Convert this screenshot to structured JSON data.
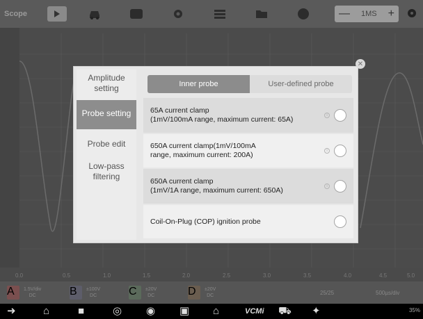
{
  "app": {
    "title": "Scope"
  },
  "toolbar": {
    "timebase": "1MS",
    "minus": "—",
    "plus": "+"
  },
  "x_axis_labels": [
    "0.0",
    "0.5",
    "1.0",
    "1.5",
    "2.0",
    "2.5",
    "3.0",
    "3.5",
    "4.0",
    "4.5",
    "5.0"
  ],
  "channels": [
    {
      "id": "A",
      "line1": "1.5V/div",
      "line2": "DC"
    },
    {
      "id": "B",
      "line1": "±100V",
      "line2": "DC"
    },
    {
      "id": "C",
      "line1": "±20V",
      "line2": "DC"
    },
    {
      "id": "D",
      "line1": "±20V",
      "line2": "DC"
    }
  ],
  "trigger": {
    "page": "25/25",
    "timediv": "500µs/div"
  },
  "dialog": {
    "sidebar": [
      {
        "label": "Amplitude setting",
        "active": false
      },
      {
        "label": "Probe setting",
        "active": true
      },
      {
        "label": "Probe edit",
        "active": false
      },
      {
        "label": "Low-pass filtering",
        "active": false
      }
    ],
    "tabs": {
      "inner": "Inner probe",
      "user": "User-defined probe"
    },
    "options": [
      {
        "line1": "65A current clamp",
        "line2": "(1mV/100mA range, maximum current: 65A)",
        "info": true
      },
      {
        "line1": "650A current clamp(1mV/100mA",
        "line2": "range, maximum current: 200A)",
        "info": true
      },
      {
        "line1": "650A current clamp",
        "line2": "(1mV/1A range, maximum current: 650A)",
        "info": true
      },
      {
        "line1": "Coil-On-Plug (COP) ignition probe",
        "line2": "",
        "info": false
      }
    ]
  },
  "status": {
    "text": "35%"
  }
}
